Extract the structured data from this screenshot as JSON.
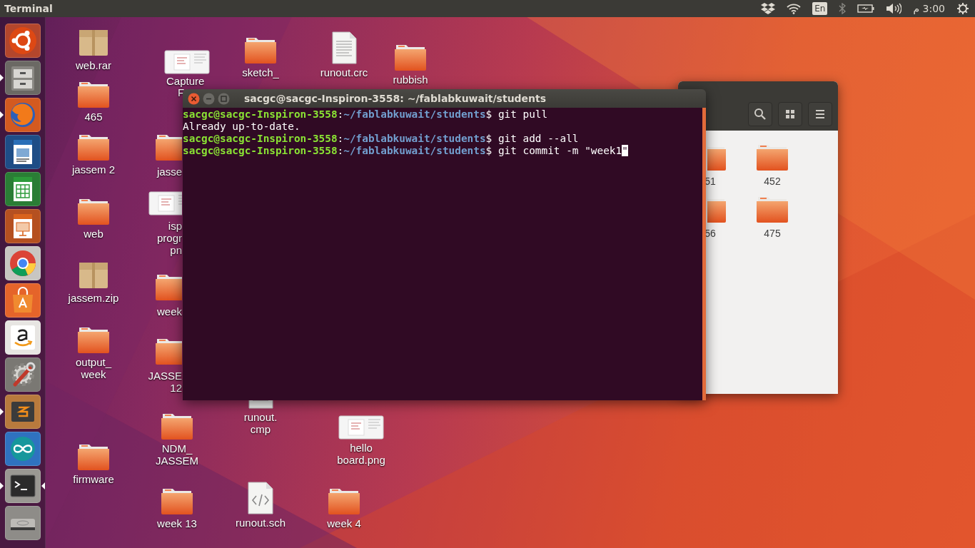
{
  "top_panel": {
    "title": "Terminal",
    "indicators": [
      {
        "kind": "dropbox"
      },
      {
        "kind": "wifi"
      },
      {
        "kind": "keyboard",
        "text": "En"
      },
      {
        "kind": "bluetooth"
      },
      {
        "kind": "battery"
      },
      {
        "kind": "volume"
      },
      {
        "kind": "clock",
        "text": "م 3:00"
      },
      {
        "kind": "power"
      }
    ]
  },
  "launcher": [
    {
      "kind": "ubuntu",
      "running": false,
      "focused": false
    },
    {
      "kind": "files",
      "running": true,
      "focused": false
    },
    {
      "kind": "firefox",
      "running": true,
      "focused": false
    },
    {
      "kind": "writer",
      "running": false,
      "focused": false
    },
    {
      "kind": "calc",
      "running": false,
      "focused": false
    },
    {
      "kind": "impress",
      "running": false,
      "focused": false
    },
    {
      "kind": "chrome",
      "running": false,
      "focused": false
    },
    {
      "kind": "software",
      "running": false,
      "focused": false
    },
    {
      "kind": "amazon",
      "running": false,
      "focused": false
    },
    {
      "kind": "settings",
      "running": false,
      "focused": false
    },
    {
      "kind": "sublime",
      "running": true,
      "focused": false
    },
    {
      "kind": "arduino",
      "running": false,
      "focused": false
    },
    {
      "kind": "terminal",
      "running": true,
      "focused": true
    },
    {
      "kind": "drive",
      "running": false,
      "focused": false
    }
  ],
  "desktop_icons": [
    {
      "kind": "archive",
      "label": [
        "web.rar"
      ]
    },
    {
      "kind": "folder",
      "label": [
        "465"
      ]
    },
    {
      "kind": "folder",
      "label": [
        "jassem 2"
      ]
    },
    {
      "kind": "folder",
      "label": [
        "web"
      ]
    },
    {
      "kind": "archive",
      "label": [
        "jassem.zip"
      ]
    },
    {
      "kind": "folder",
      "label": [
        "output_",
        "week"
      ]
    },
    {
      "kind": "folder",
      "label": [
        "firmware"
      ]
    },
    {
      "kind": "image",
      "label": [
        "Capture",
        "F"
      ]
    },
    {
      "kind": "folder",
      "label": [
        "sketch_"
      ]
    },
    {
      "kind": "file",
      "label": [
        "runout.crc"
      ]
    },
    {
      "kind": "folder",
      "label": [
        "rubbish"
      ]
    },
    {
      "kind": "folder",
      "label": [
        "jasse"
      ]
    },
    {
      "kind": "image",
      "label": [
        "isp",
        "progr",
        "pn"
      ]
    },
    {
      "kind": "folder",
      "label": [
        "week"
      ]
    },
    {
      "kind": "folder",
      "label": [
        "JASSE",
        "12"
      ]
    },
    {
      "kind": "file",
      "label": [
        "runout.",
        "cmp"
      ]
    },
    {
      "kind": "folder",
      "label": [
        "NDM_",
        "JASSEM"
      ]
    },
    {
      "kind": "image",
      "label": [
        "hello",
        "board.png"
      ]
    },
    {
      "kind": "folder",
      "label": [
        "week 13"
      ]
    },
    {
      "kind": "code",
      "label": [
        "runout.sch"
      ]
    },
    {
      "kind": "folder",
      "label": [
        "week 4"
      ]
    }
  ],
  "file_manager": {
    "folders": [
      {
        "label": "51"
      },
      {
        "label": "452"
      },
      {
        "label": "56"
      },
      {
        "label": "475"
      }
    ]
  },
  "terminal": {
    "title": "sacgc@sacgc-Inspiron-3558: ~/fablabkuwait/students",
    "lines": [
      {
        "kind": "prompt",
        "user": "sacgc@sacgc-Inspiron-3558",
        "colon": ":",
        "path": "~/fablabkuwait/students",
        "command": "$ git pull"
      },
      {
        "kind": "output",
        "text": "Already up-to-date."
      },
      {
        "kind": "prompt",
        "user": "sacgc@sacgc-Inspiron-3558",
        "colon": ":",
        "path": "~/fablabkuwait/students",
        "command": "$ git add --all"
      },
      {
        "kind": "prompt",
        "user": "sacgc@sacgc-Inspiron-3558",
        "colon": ":",
        "path": "~/fablabkuwait/students",
        "command": "$ git commit -m \"week1",
        "cursor_text": "\""
      }
    ]
  }
}
